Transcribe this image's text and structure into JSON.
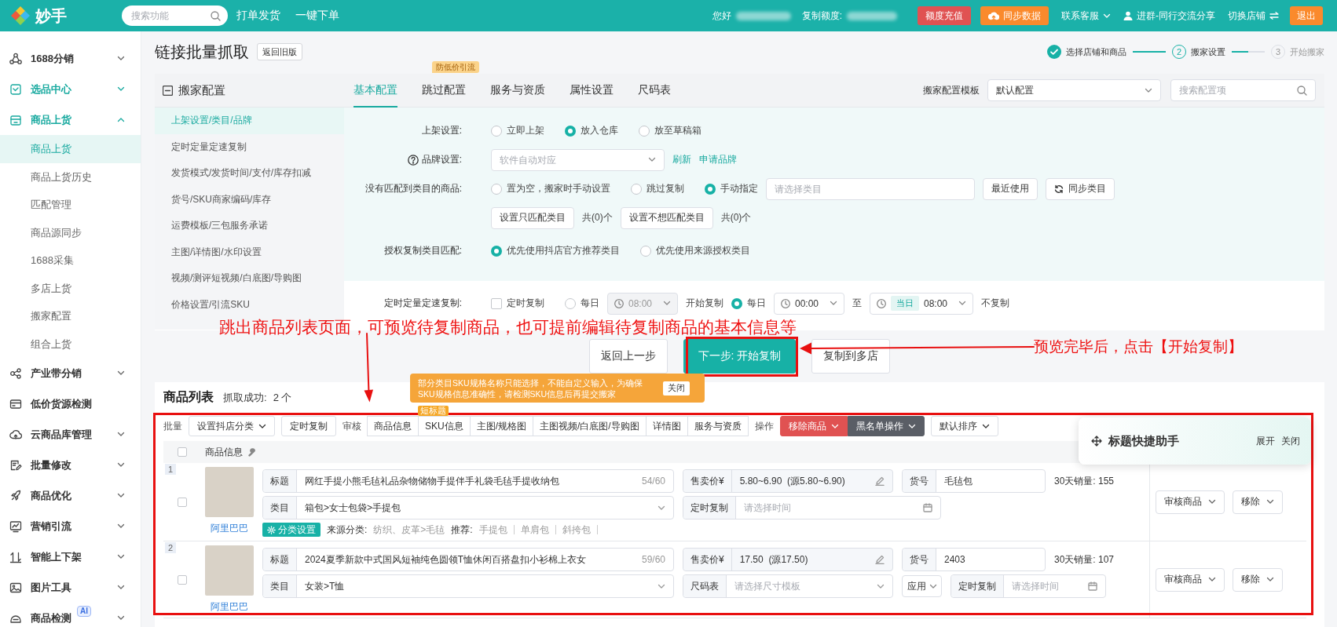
{
  "header": {
    "logo": "妙手",
    "search": {
      "placeholder": "搜索功能"
    },
    "nav": [
      {
        "label": "打单发货"
      },
      {
        "label": "一键下单"
      }
    ],
    "greeting": "您好",
    "quota_label": "复制额度:",
    "buttons": [
      {
        "label": "额度充值",
        "kind": "danger"
      },
      {
        "label": "同步数据",
        "kind": "warning"
      }
    ],
    "links": [
      {
        "label": "联系客服",
        "kind": "dropdown"
      },
      {
        "label": "进群-同行交流分享",
        "kind": "user"
      },
      {
        "label": "切换店铺",
        "kind": "switch"
      }
    ],
    "logout": "退出"
  },
  "sidebar": {
    "items": [
      {
        "label": "1688分销",
        "active": false,
        "expanded": false
      },
      {
        "label": "选品中心",
        "active": true,
        "expanded": false
      },
      {
        "label": "商品上货",
        "active": true,
        "expanded": true,
        "children": [
          {
            "label": "商品上货",
            "selected": true
          },
          {
            "label": "商品上货历史",
            "selected": false
          },
          {
            "label": "匹配管理",
            "selected": false
          },
          {
            "label": "商品源同步",
            "selected": false
          },
          {
            "label": "1688采集",
            "selected": false
          },
          {
            "label": "多店上货",
            "selected": false
          },
          {
            "label": "搬家配置",
            "selected": false
          },
          {
            "label": "组合上货",
            "selected": false
          }
        ]
      },
      {
        "label": "产业带分销",
        "active": false,
        "expanded": false
      },
      {
        "label": "低价货源检测",
        "active": false
      },
      {
        "label": "云商品库管理",
        "active": false,
        "expanded": false
      },
      {
        "label": "批量修改",
        "active": false,
        "expanded": false
      },
      {
        "label": "商品优化",
        "active": false,
        "expanded": false
      },
      {
        "label": "营销引流",
        "active": false,
        "expanded": false
      },
      {
        "label": "智能上下架",
        "active": false,
        "expanded": false
      },
      {
        "label": "图片工具",
        "active": false,
        "expanded": false
      },
      {
        "label": "商品检测",
        "active": false,
        "expanded": false,
        "badge": "AI"
      }
    ]
  },
  "page": {
    "title": "链接批量抓取",
    "back_button": "返回旧版",
    "steps": [
      {
        "label": "选择店铺和商品",
        "completed": true
      },
      {
        "number": "2",
        "label": "搬家设置",
        "completed": false,
        "active": true
      },
      {
        "number": "3",
        "label": "开始搬家",
        "completed": false,
        "active": false
      }
    ]
  },
  "config": {
    "title": "搬家配置",
    "tabs": [
      {
        "label": "基本配置",
        "selected": true
      },
      {
        "label": "跳过配置",
        "selected": false,
        "badge": "防低价引流"
      },
      {
        "label": "服务与资质",
        "selected": false
      },
      {
        "label": "属性设置",
        "selected": false
      },
      {
        "label": "尺码表",
        "selected": false
      }
    ],
    "template_label": "搬家配置模板",
    "template": "默认配置",
    "search_placeholder": "搜索配置项",
    "menu": [
      {
        "label": "上架设置/类目/品牌",
        "selected": true
      },
      {
        "label": "定时定量定速复制",
        "selected": false
      },
      {
        "label": "发货模式/发货时间/支付/库存扣减",
        "selected": false
      },
      {
        "label": "货号/SKU商家编码/库存",
        "selected": false
      },
      {
        "label": "运费模板/三包服务承诺",
        "selected": false
      },
      {
        "label": "主图/详情图/水印设置",
        "selected": false
      },
      {
        "label": "视频/测评短视频/白底图/导购图",
        "selected": false
      },
      {
        "label": "价格设置/引流SKU",
        "selected": false
      }
    ],
    "form": [
      {
        "label": "上架设置:",
        "controls": [
          {
            "kind": "radio",
            "label": "立即上架",
            "selected": false
          },
          {
            "kind": "radio",
            "label": "放入仓库",
            "selected": true
          },
          {
            "kind": "radio",
            "label": "放至草稿箱",
            "selected": false
          }
        ]
      },
      {
        "label": "品牌设置:",
        "help": true,
        "controls": [
          {
            "kind": "select",
            "placeholder": "软件自动对应"
          },
          {
            "kind": "link",
            "label": "刷新"
          },
          {
            "kind": "link",
            "label": "申请品牌"
          }
        ]
      },
      {
        "label": "没有匹配到类目的商品:",
        "controls": [
          {
            "kind": "radio",
            "label": "置为空，搬家时手动设置",
            "selected": false
          },
          {
            "kind": "radio",
            "label": "跳过复制",
            "selected": false
          },
          {
            "kind": "radio",
            "label": "手动指定",
            "selected": true
          },
          {
            "kind": "input",
            "placeholder": "请选择类目"
          },
          {
            "kind": "button",
            "label": "最近使用"
          },
          {
            "kind": "sync_button",
            "label": "同步类目"
          }
        ]
      },
      {
        "controls": [
          {
            "kind": "button",
            "label": "设置只匹配类目"
          },
          {
            "kind": "text",
            "label": "共(0)个"
          },
          {
            "kind": "button",
            "label": "设置不想匹配类目"
          },
          {
            "kind": "text",
            "label": "共(0)个"
          }
        ]
      },
      {
        "label": "授权复制类目匹配:",
        "controls": [
          {
            "kind": "radio",
            "label": "优先使用抖店官方推荐类目",
            "selected": true
          },
          {
            "kind": "radio",
            "label": "优先使用来源授权类目",
            "selected": false
          }
        ]
      }
    ],
    "schedule": {
      "label": "定时定量定速复制:",
      "controls": [
        {
          "kind": "checkbox",
          "label": "定时复制",
          "checked": false
        },
        {
          "kind": "radio",
          "label": "每日",
          "selected": false
        },
        {
          "kind": "time",
          "value": "08:00",
          "disabled": true
        },
        {
          "kind": "text",
          "label": "开始复制"
        },
        {
          "kind": "radio",
          "label": "每日",
          "selected": true
        },
        {
          "kind": "time",
          "value": "00:00",
          "disabled": false
        },
        {
          "kind": "text",
          "label": "至"
        },
        {
          "kind": "time",
          "tag": "当日",
          "value": "08:00",
          "disabled": false
        },
        {
          "kind": "text",
          "label": "不复制"
        }
      ]
    }
  },
  "actions": [
    {
      "label": "返回上一步",
      "kind": "default"
    },
    {
      "label": "下一步: 开始复制",
      "kind": "primary"
    },
    {
      "label": "复制到多店",
      "kind": "default"
    }
  ],
  "products": {
    "title": "商品列表",
    "status_label": "抓取成功:",
    "count": "2 个",
    "tooltip": {
      "text": "部分类目SKU规格名称只能选择，不能自定义输入，为确保SKU规格信息准确性，请检测SKU信息后再提交搬家",
      "close": "关闭"
    },
    "toolbar": [
      {
        "kind": "label",
        "label": "批量"
      },
      {
        "kind": "dropdown",
        "label": "设置抖店分类"
      },
      {
        "kind": "button",
        "label": "定时复制"
      },
      {
        "kind": "label",
        "label": "审核"
      },
      {
        "kind": "segmented",
        "items": [
          {
            "label": "商品信息"
          },
          {
            "label": "SKU信息",
            "badge": "短标题"
          },
          {
            "label": "主图/规格图"
          },
          {
            "label": "主图视频/白底图/导购图"
          },
          {
            "label": "详情图"
          },
          {
            "label": "服务与资质"
          }
        ]
      },
      {
        "kind": "label",
        "label": "操作"
      },
      {
        "kind": "danger_dropdown",
        "label": "移除商品"
      },
      {
        "kind": "dark_dropdown",
        "label": "黑名单操作"
      },
      {
        "kind": "dropdown",
        "label": "默认排序"
      }
    ],
    "header_checked": false,
    "column": "商品信息",
    "rows": [
      {
        "index": "1",
        "checked": false,
        "source": "阿里巴巴",
        "lines": [
          [
            {
              "kind": "title",
              "label": "标题",
              "value": "网红手提小熊毛毡礼品杂物储物手提伴手礼袋毛毡手提收纳包",
              "counter": "54/60"
            },
            {
              "kind": "price",
              "label": "售卖价¥",
              "value": "5.80~6.90  (源5.80~6.90)"
            },
            {
              "kind": "sku",
              "label": "货号",
              "value": "毛毡包"
            },
            {
              "kind": "sales",
              "text": "30天销量: 155"
            }
          ],
          [
            {
              "kind": "category",
              "label": "类目",
              "value": "箱包>女士包袋>手提包"
            },
            {
              "kind": "schedule",
              "label": "定时复制",
              "placeholder": "请选择时间"
            }
          ]
        ],
        "category_tools": {
          "button": "分类设置",
          "source_label": "来源分类:",
          "source_value": "纺织、皮革>毛毡",
          "recommend_label": "推荐:",
          "tags": [
            "手提包",
            "单肩包",
            "斜挎包"
          ]
        },
        "actions": [
          {
            "label": "审核商品"
          },
          {
            "label": "移除"
          }
        ]
      },
      {
        "index": "2",
        "checked": false,
        "source": "阿里巴巴",
        "lines": [
          [
            {
              "kind": "title",
              "label": "标题",
              "value": "2024夏季新款中式国风短袖纯色圆领T恤休闲百搭盘扣小衫棉上衣女",
              "counter": "59/60"
            },
            {
              "kind": "price",
              "label": "售卖价¥",
              "value": "17.50  (源17.50)"
            },
            {
              "kind": "sku",
              "label": "货号",
              "value": "2403"
            },
            {
              "kind": "sales",
              "text": "30天销量: 107"
            }
          ],
          [
            {
              "kind": "category",
              "label": "类目",
              "value": "女装>T恤"
            },
            {
              "kind": "size_chart",
              "label": "尺码表",
              "placeholder": "请选择尺寸模板"
            },
            {
              "kind": "apply",
              "label": "应用"
            },
            {
              "kind": "schedule",
              "label": "定时复制",
              "placeholder": "请选择时间"
            }
          ]
        ],
        "actions": [
          {
            "label": "审核商品"
          },
          {
            "label": "移除"
          }
        ]
      }
    ]
  },
  "helper": {
    "title": "标题快捷助手",
    "links": [
      "展开",
      "关闭"
    ]
  },
  "annotations": [
    {
      "kind": "note",
      "text": "跳出商品列表页面，可预览待复制商品，也可提前编辑待复制商品的基本信息等"
    },
    {
      "kind": "note",
      "text": "预览完毕后，点击【开始复制】"
    },
    {
      "kind": "arrow"
    },
    {
      "kind": "arrow"
    },
    {
      "kind": "box"
    },
    {
      "kind": "box"
    }
  ]
}
